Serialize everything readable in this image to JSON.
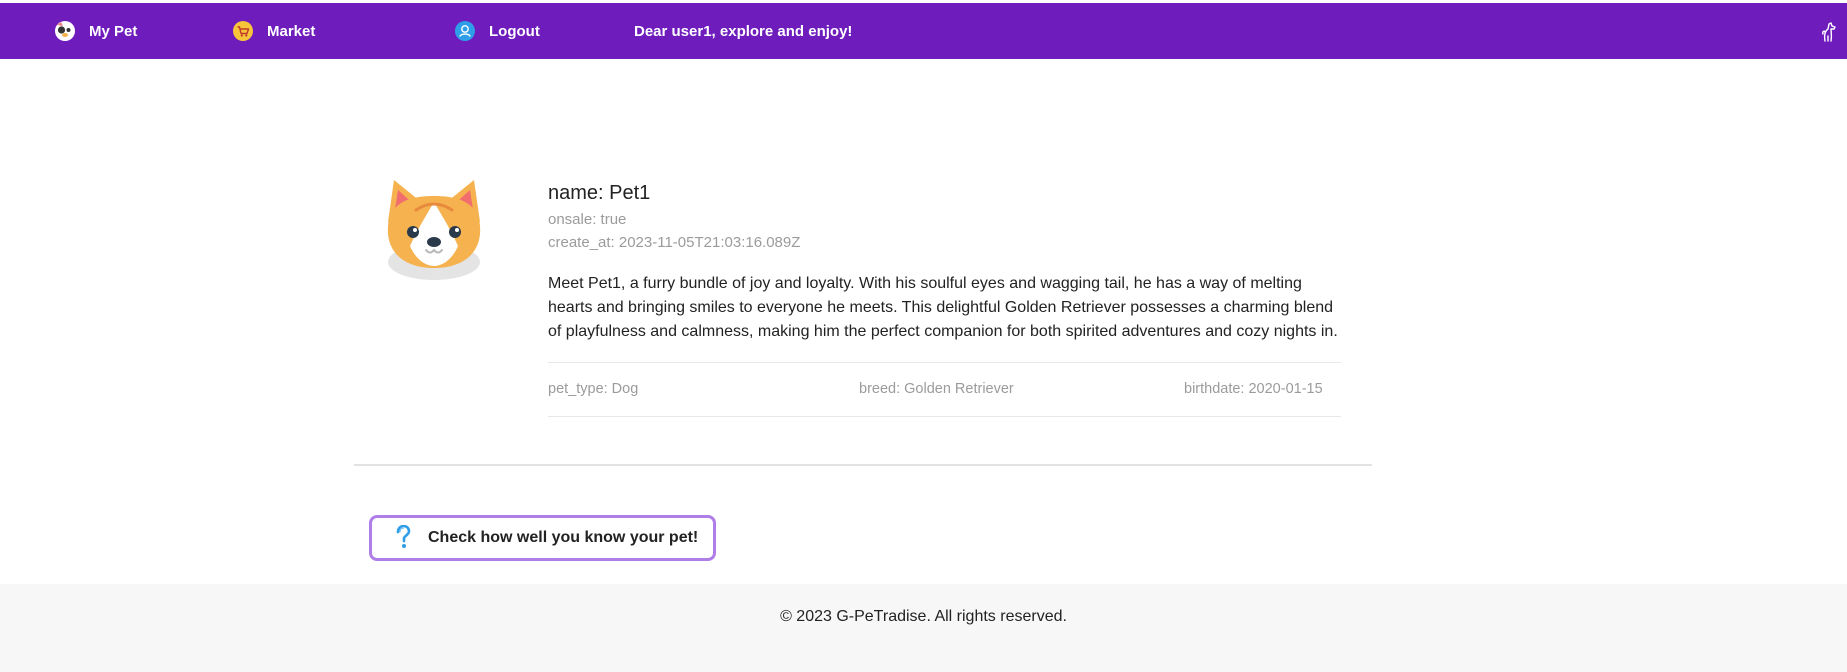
{
  "nav": {
    "my_pet": "My Pet",
    "market": "Market",
    "logout": "Logout",
    "welcome": "Dear user1, explore and enjoy!",
    "background": "#6f1cbd"
  },
  "pet": {
    "name_line": "name: Pet1",
    "onsale_line": "onsale: true",
    "created_line": "create_at: 2023-11-05T21:03:16.089Z",
    "description": "Meet Pet1, a furry bundle of joy and loyalty. With his soulful eyes and wagging tail, he has a way of melting hearts and bringing smiles to everyone he meets. This delightful Golden Retriever possesses a charming blend of playfulness and calmness, making him the perfect companion for both spirited adventures and cozy nights in.",
    "pet_type_line": "pet_type: Dog",
    "breed_line": "breed: Golden Retriever",
    "birthdate_line": "birthdate: 2020-01-15",
    "avatar_icon": "corgi-avatar-icon"
  },
  "quiz": {
    "label": "Check how well you know your pet!",
    "icon": "question-mark-icon",
    "border_color": "#b07ee8"
  },
  "footer": {
    "text": "© 2023 G-PeTradise. All rights reserved."
  }
}
